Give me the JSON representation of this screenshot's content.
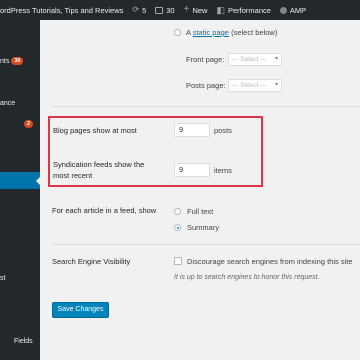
{
  "admin_bar": {
    "site_name": "ordPress Tutorials, Tips and Reviews",
    "updates_count": "5",
    "comments_count": "30",
    "new_label": "New",
    "performance_label": "Performance",
    "amp_label": "AMP"
  },
  "sidebar": {
    "items": [
      {
        "label": "nts",
        "badge": "30"
      },
      {
        "label": "ance"
      },
      {
        "label": "",
        "badge": "2"
      },
      {
        "label": "st"
      },
      {
        "label": "Fields"
      }
    ]
  },
  "reading": {
    "static_page_prefix": "A",
    "static_page_link": "static page",
    "static_page_suffix": "(select below)",
    "front_page_label": "Front page:",
    "front_page_select": "— Select —",
    "posts_page_label": "Posts page:",
    "posts_page_select": "— Select —",
    "blog_pages_label": "Blog pages show at most",
    "blog_pages_value": "9",
    "blog_pages_unit": "posts",
    "syndication_label_line1": "Syndication feeds show the",
    "syndication_label_line2": "most recent",
    "syndication_value": "9",
    "syndication_unit": "items",
    "feed_label": "For each article in a feed, show",
    "full_text_label": "Full text",
    "summary_label": "Summary",
    "search_engine_label": "Search Engine Visibility",
    "discourage_label": "Discourage search engines from indexing this site",
    "honor_note": "It is up to search engines to honor this request.",
    "save_button": "Save Changes"
  },
  "colors": {
    "highlight": "#dc3545",
    "accent": "#0073aa",
    "button": "#0085ba"
  }
}
